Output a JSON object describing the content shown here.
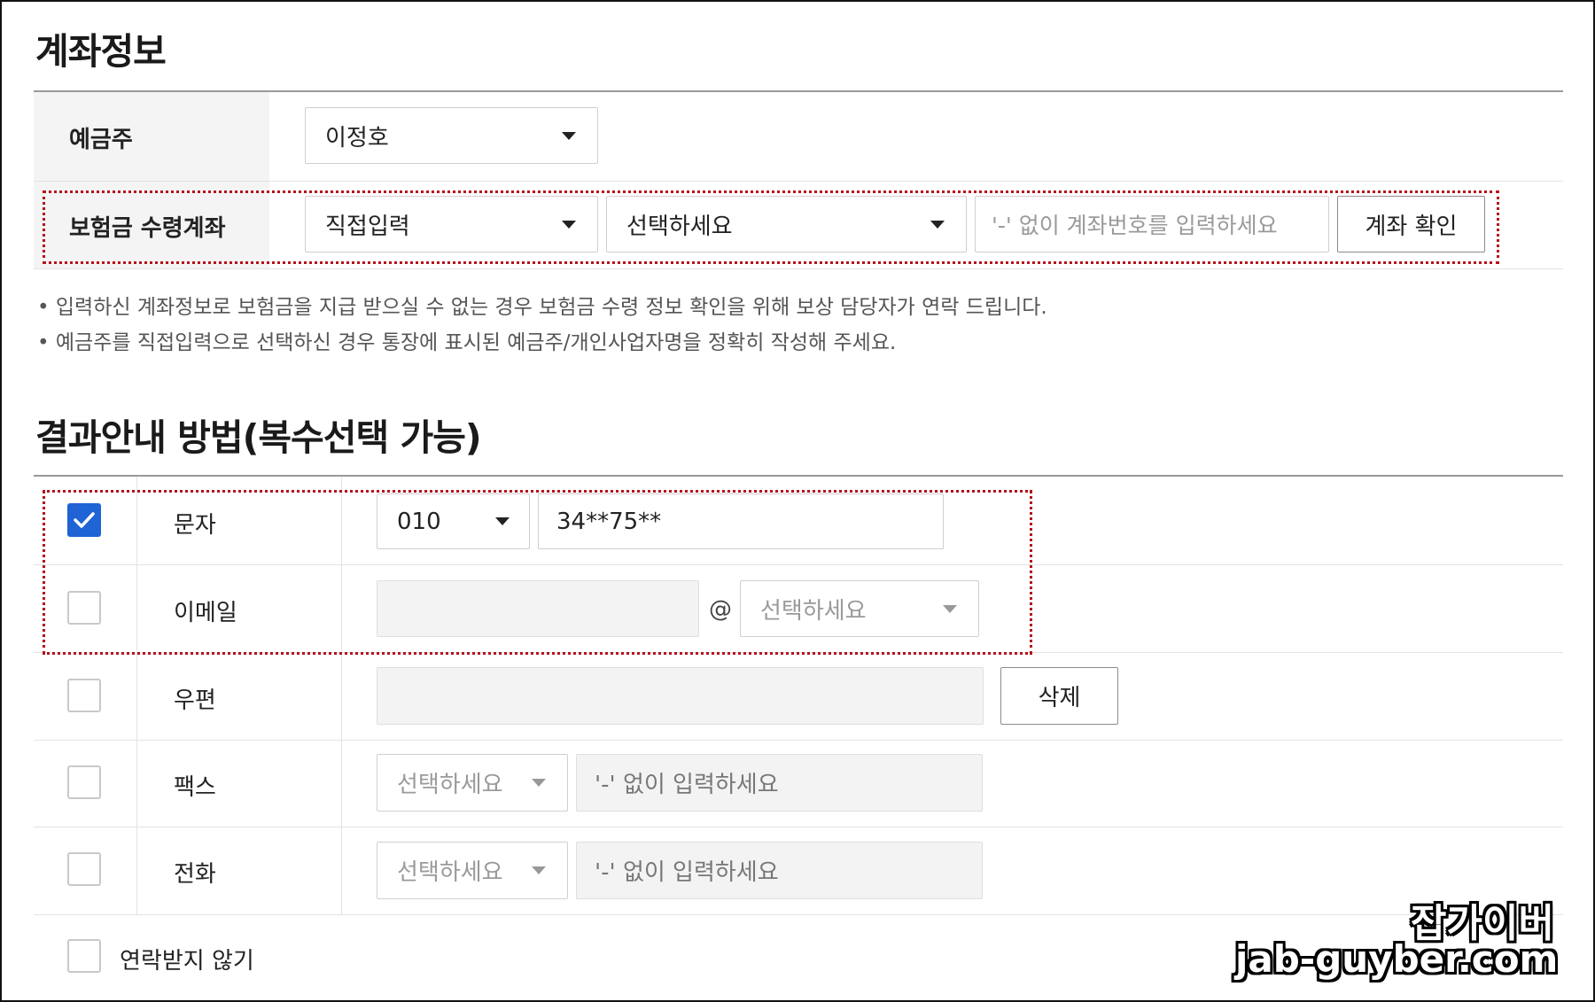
{
  "account_section": {
    "title": "계좌정보",
    "holder": {
      "label": "예금주",
      "value": "이정호"
    },
    "payout_account": {
      "label": "보험금 수령계좌",
      "method_value": "직접입력",
      "bank_value": "선택하세요",
      "account_placeholder": "'-' 없이 계좌번호를 입력하세요",
      "verify_button": "계좌 확인"
    },
    "notes": [
      "입력하신 계좌정보로 보험금을 지급 받으실 수 없는 경우 보험금 수령 정보 확인을 위해 보상 담당자가 연락 드립니다.",
      "예금주를 직접입력으로 선택하신 경우 통장에 표시된 예금주/개인사업자명을 정확히 작성해 주세요."
    ]
  },
  "result_section": {
    "title": "결과안내 방법(복수선택 가능)",
    "sms": {
      "label": "문자",
      "checked": true,
      "prefix": "010",
      "number": "34**75**"
    },
    "email": {
      "label": "이메일",
      "checked": false,
      "at": "@",
      "domain_placeholder": "선택하세요"
    },
    "post": {
      "label": "우편",
      "checked": false,
      "delete_button": "삭제"
    },
    "fax": {
      "label": "팩스",
      "checked": false,
      "select_placeholder": "선택하세요",
      "input_placeholder": "'-' 없이 입력하세요"
    },
    "phone": {
      "label": "전화",
      "checked": false,
      "select_placeholder": "선택하세요",
      "input_placeholder": "'-' 없이 입력하세요"
    },
    "no_contact": {
      "label": "연락받지 않기",
      "checked": false
    }
  },
  "watermark": {
    "line1": "잡가이버",
    "line2": "jab-guyber.com"
  },
  "colors": {
    "accent": "#1f63d4",
    "highlight_border": "#b5121b"
  }
}
